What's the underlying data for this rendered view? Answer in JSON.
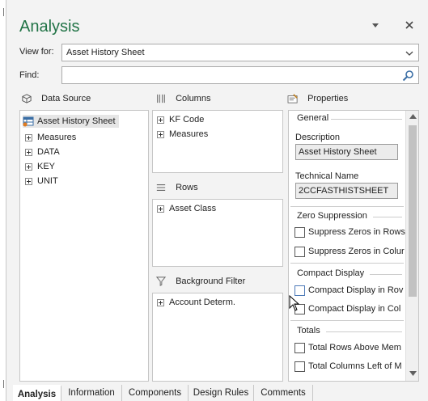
{
  "pane": {
    "title": "Analysis"
  },
  "view_for": {
    "label": "View for:",
    "value": "Asset History Sheet"
  },
  "find": {
    "label": "Find:",
    "placeholder": ""
  },
  "data_source": {
    "header": "Data Source",
    "root": "Asset History Sheet",
    "items": [
      "Measures",
      "DATA",
      "KEY",
      "UNIT"
    ]
  },
  "columns": {
    "header": "Columns",
    "items": [
      "KF Code",
      "Measures"
    ]
  },
  "rows": {
    "header": "Rows",
    "items": [
      "Asset Class"
    ]
  },
  "background_filter": {
    "header": "Background Filter",
    "items": [
      "Account Determ."
    ]
  },
  "properties": {
    "header": "Properties",
    "general": {
      "title": "General",
      "description_label": "Description",
      "description_value": "Asset History Sheet",
      "technical_label": "Technical Name",
      "technical_value": "2CCFASTHISTSHEET"
    },
    "zero_suppression": {
      "title": "Zero Suppression",
      "options": [
        "Suppress Zeros in Rows",
        "Suppress Zeros in Colur"
      ]
    },
    "compact_display": {
      "title": "Compact Display",
      "options": [
        "Compact Display in Rov",
        "Compact Display in Col"
      ]
    },
    "totals": {
      "title": "Totals",
      "options": [
        "Total Rows Above Mem",
        "Total Columns Left of M"
      ]
    }
  },
  "tabs": [
    "Analysis",
    "Information",
    "Components",
    "Design Rules",
    "Comments"
  ],
  "active_tab": "Analysis"
}
